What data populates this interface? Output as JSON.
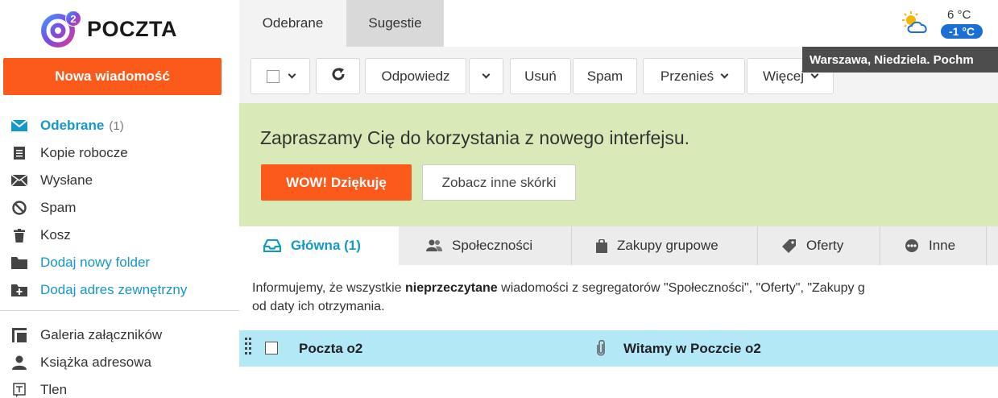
{
  "app": {
    "logo_text": "POCZTA",
    "logo_badge": "2"
  },
  "compose_button": "Nowa wiadomość",
  "folders": [
    {
      "label": "Odebrane",
      "count": "(1)",
      "icon": "envelope-icon"
    },
    {
      "label": "Kopie robocze",
      "icon": "draft-icon"
    },
    {
      "label": "Wysłane",
      "icon": "sent-icon"
    },
    {
      "label": "Spam",
      "icon": "ban-icon"
    },
    {
      "label": "Kosz",
      "icon": "trash-icon"
    },
    {
      "label": "Dodaj nowy folder",
      "icon": "folder-icon"
    },
    {
      "label": "Dodaj adres zewnętrzny",
      "icon": "folder-add-icon"
    }
  ],
  "tools": [
    {
      "label": "Galeria załączników",
      "icon": "gallery-icon"
    },
    {
      "label": "Książka adresowa",
      "icon": "person-icon"
    },
    {
      "label": "Tlen",
      "icon": "tlen-icon"
    }
  ],
  "top_tabs": [
    "Odebrane",
    "Sugestie"
  ],
  "weather": {
    "high": "6 °C",
    "low": "-1 °C",
    "tooltip": "Warszawa, Niedziela. Pochm"
  },
  "toolbar": {
    "reply": "Odpowiedz",
    "delete": "Usuń",
    "spam": "Spam",
    "move": "Przenieś",
    "more": "Więcej"
  },
  "promo": {
    "text": "Zapraszamy Cię do korzystania z nowego interfejsu.",
    "primary": "WOW! Dziękuję",
    "secondary": "Zobacz inne skórki"
  },
  "category_tabs": [
    {
      "label": "Główna (1)",
      "icon": "inbox-tray-icon"
    },
    {
      "label": "Społeczności",
      "icon": "people-icon"
    },
    {
      "label": "Zakupy grupowe",
      "icon": "shopping-bag-icon"
    },
    {
      "label": "Oferty",
      "icon": "tag-icon"
    },
    {
      "label": "Inne",
      "icon": "dots-icon"
    }
  ],
  "info": {
    "prefix": "Informujemy, że wszystkie ",
    "bold": "nieprzeczytane",
    "suffix": " wiadomości z segregatorów \"Społeczności\", \"Oferty\", \"Zakupy g",
    "line2": "od daty ich otrzymania."
  },
  "messages": [
    {
      "sender": "Poczta o2",
      "subject": "Witamy w Poczcie o2",
      "has_attachment": true
    }
  ],
  "colors": {
    "accent": "#fb5a1a",
    "link": "#1598c9",
    "promo_bg": "#d9eab8",
    "selected_row": "#b3e9f7"
  }
}
